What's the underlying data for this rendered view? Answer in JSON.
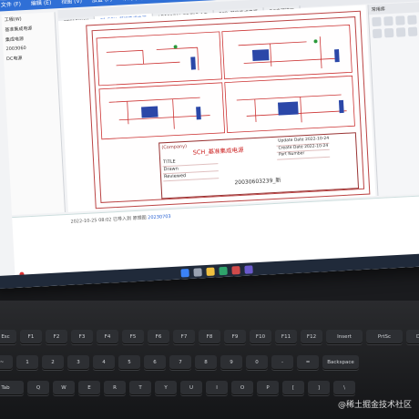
{
  "bookmarks": [
    "java",
    "frontend",
    "catch",
    "community",
    "tools",
    "Movie",
    "module",
    "blog",
    "oplu",
    "work",
    "CSI"
  ],
  "menu": [
    "文件 (F)",
    "编辑 (E)",
    "视图 (V)",
    "放置 (P)",
    "布局 (O)",
    "工具 (T)",
    "帮助 (D)",
    "下载 (A)",
    "帮助 (H)"
  ],
  "menu_login": "直播挂机",
  "tabs": [
    {
      "label": "STC15W4K",
      "active": false
    },
    {
      "label": "P1 SCH_基准集成电源",
      "active": true
    },
    {
      "label": "LD1117AL-33-TA3-A-T",
      "active": false
    },
    {
      "label": "PCB_基准集成电源",
      "active": false
    },
    {
      "label": "DC电源接口",
      "active": false
    }
  ],
  "left_panel": [
    "工程(W)",
    "基准集成电源",
    "集成电源",
    "2003060",
    "DC电源"
  ],
  "right_panel": {
    "title": "常用库"
  },
  "title_block": {
    "company": "(Company)",
    "title": "SCH_基准集成电源",
    "rows": [
      "TITLE",
      "Drawn",
      "Reviewed"
    ],
    "update_label": "Update Date",
    "update_date": "2022-10-24",
    "create_label": "Create Date",
    "create_date": "2022-10-24",
    "part_label": "Part Number",
    "subtitle": "20030603239_新"
  },
  "log": {
    "prefix": "2022-10-25 08:02",
    "text": "已导入到 原理图",
    "link": "20230703"
  },
  "keyboard": {
    "fn_row": [
      "Esc",
      "F1",
      "F2",
      "F3",
      "F4",
      "F5",
      "F6",
      "F7",
      "F8",
      "F9",
      "F10",
      "F11",
      "F12",
      "Insert",
      "PrtSc",
      "Delete"
    ],
    "num_row": [
      "~",
      "1",
      "2",
      "3",
      "4",
      "5",
      "6",
      "7",
      "8",
      "9",
      "0",
      "-",
      "=",
      "Backspace"
    ],
    "qwerty_row": [
      "Tab",
      "Q",
      "W",
      "E",
      "R",
      "T",
      "Y",
      "U",
      "I",
      "O",
      "P",
      "[",
      "]",
      "\\"
    ]
  },
  "watermark": "@稀土掘金技术社区",
  "colors": {
    "menubar": "#2f6fd6",
    "bookmarks": "#5a86d8",
    "schematic": "#b44444",
    "taskbar": "#202a3a"
  }
}
